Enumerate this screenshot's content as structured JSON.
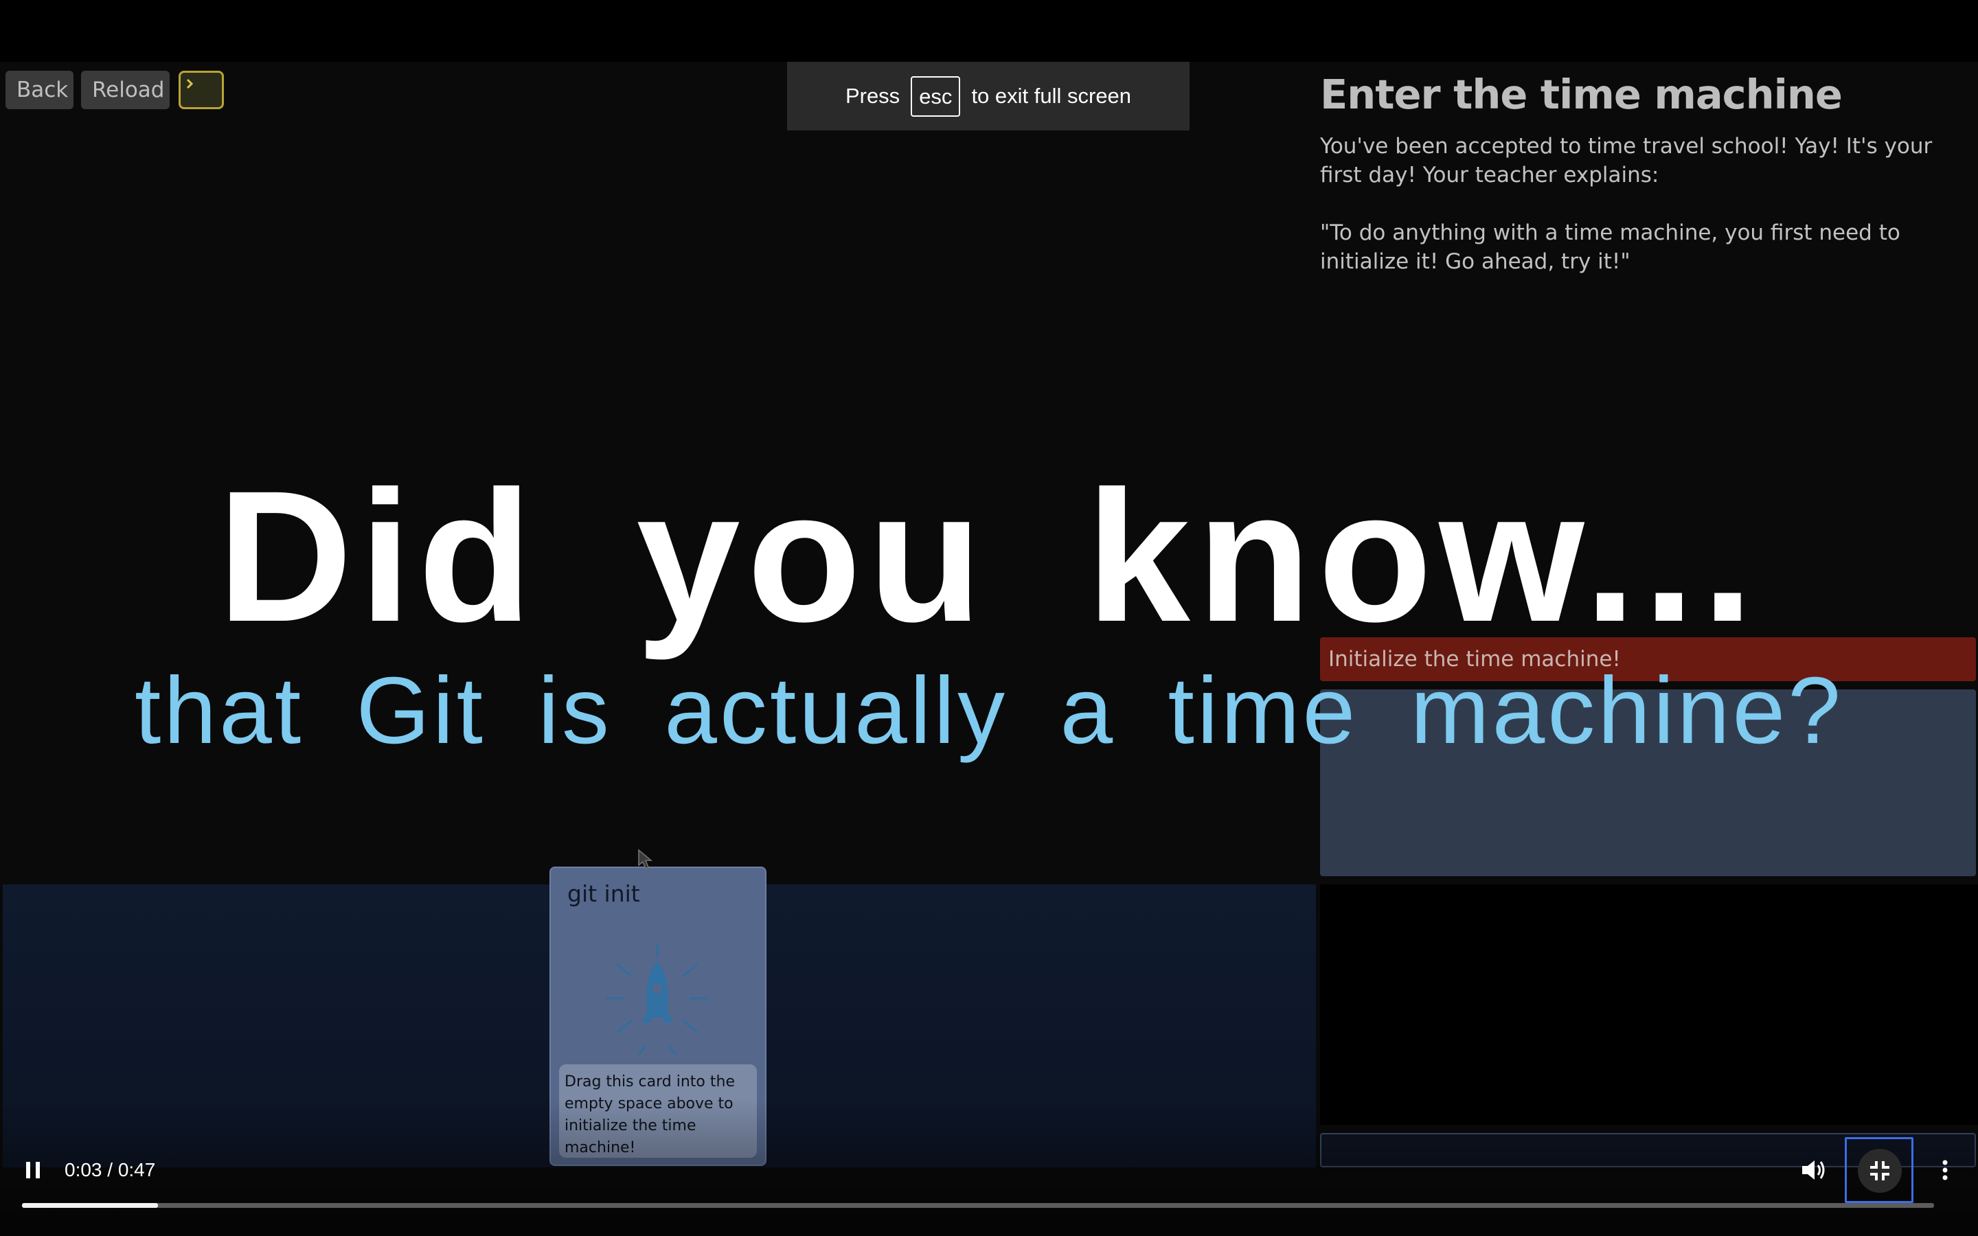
{
  "game": {
    "back_label": "Back",
    "reload_label": "Reload",
    "level_title": "Enter the time machine",
    "description": [
      "You've been accepted to time travel school! Yay! It's your first day! Your teacher explains:",
      "\"To do anything with a time machine, you first need to initialize it! Go ahead, try it!\""
    ],
    "goal": "Initialize the time machine!",
    "card": {
      "title": "git init",
      "description": "Drag this card into the empty space above to initialize the time machine!",
      "icon": "rocket-icon"
    }
  },
  "fullscreen_notice": {
    "before": "Press",
    "key": "esc",
    "after": "to exit full screen"
  },
  "video": {
    "headline": "Did you know...",
    "subtitle": "that Git is actually a time machine?",
    "current_time": "0:03",
    "duration": "0:47",
    "time_display": "0:03 / 0:47",
    "progress": 0.071,
    "state": "playing"
  },
  "colors": {
    "goal_bar": "#6b1a12",
    "drop_zone": "#303c4e",
    "card": "#56678c",
    "subtitle_text": "#7fcaef",
    "focus_ring": "#3b6ee6"
  }
}
